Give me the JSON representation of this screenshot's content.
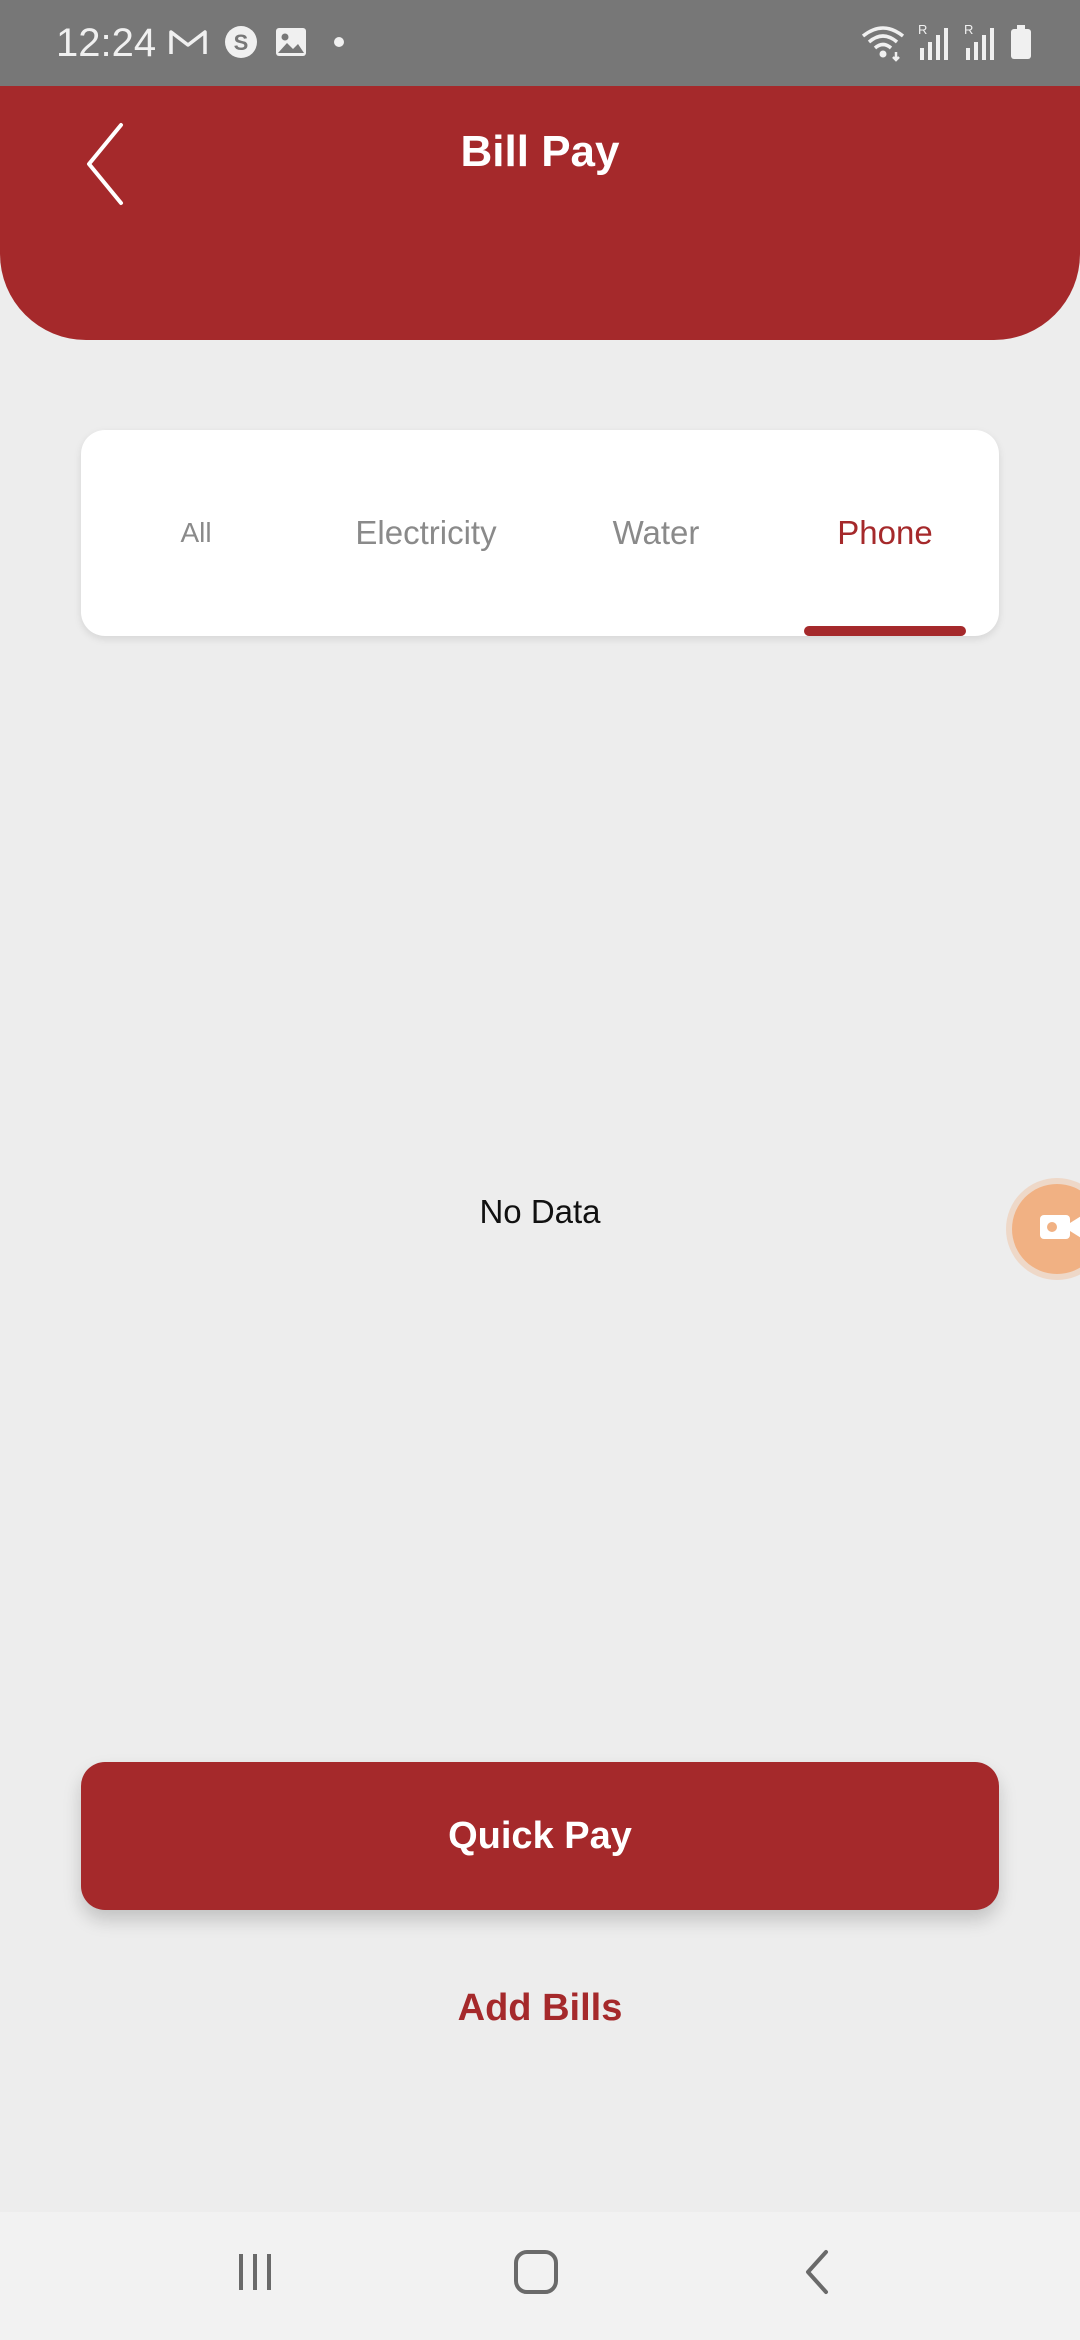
{
  "status_bar": {
    "time": "12:24",
    "left_icons": [
      "gmail-icon",
      "skype-icon",
      "gallery-icon",
      "dot-icon"
    ],
    "right_icons": [
      "wifi-icon",
      "signal-r-icon",
      "signal-r-icon",
      "battery-icon"
    ],
    "signal_roaming_label": "R"
  },
  "header": {
    "title": "Bill Pay",
    "back_icon": "chevron-left-icon"
  },
  "tabs": [
    {
      "label": "All",
      "active": false
    },
    {
      "label": "Electricity",
      "active": false
    },
    {
      "label": "Water",
      "active": false
    },
    {
      "label": "Phone",
      "active": true
    }
  ],
  "main": {
    "empty_text": "No Data"
  },
  "actions": {
    "quick_pay_label": "Quick Pay",
    "add_bills_label": "Add Bills"
  },
  "nav_bar": {
    "icons": [
      "recents-icon",
      "home-icon",
      "back-icon"
    ]
  },
  "colors": {
    "brand": "#a5292b",
    "background": "#ededed",
    "status_bar": "#777777",
    "inactive_tab": "#8a8a8a"
  }
}
